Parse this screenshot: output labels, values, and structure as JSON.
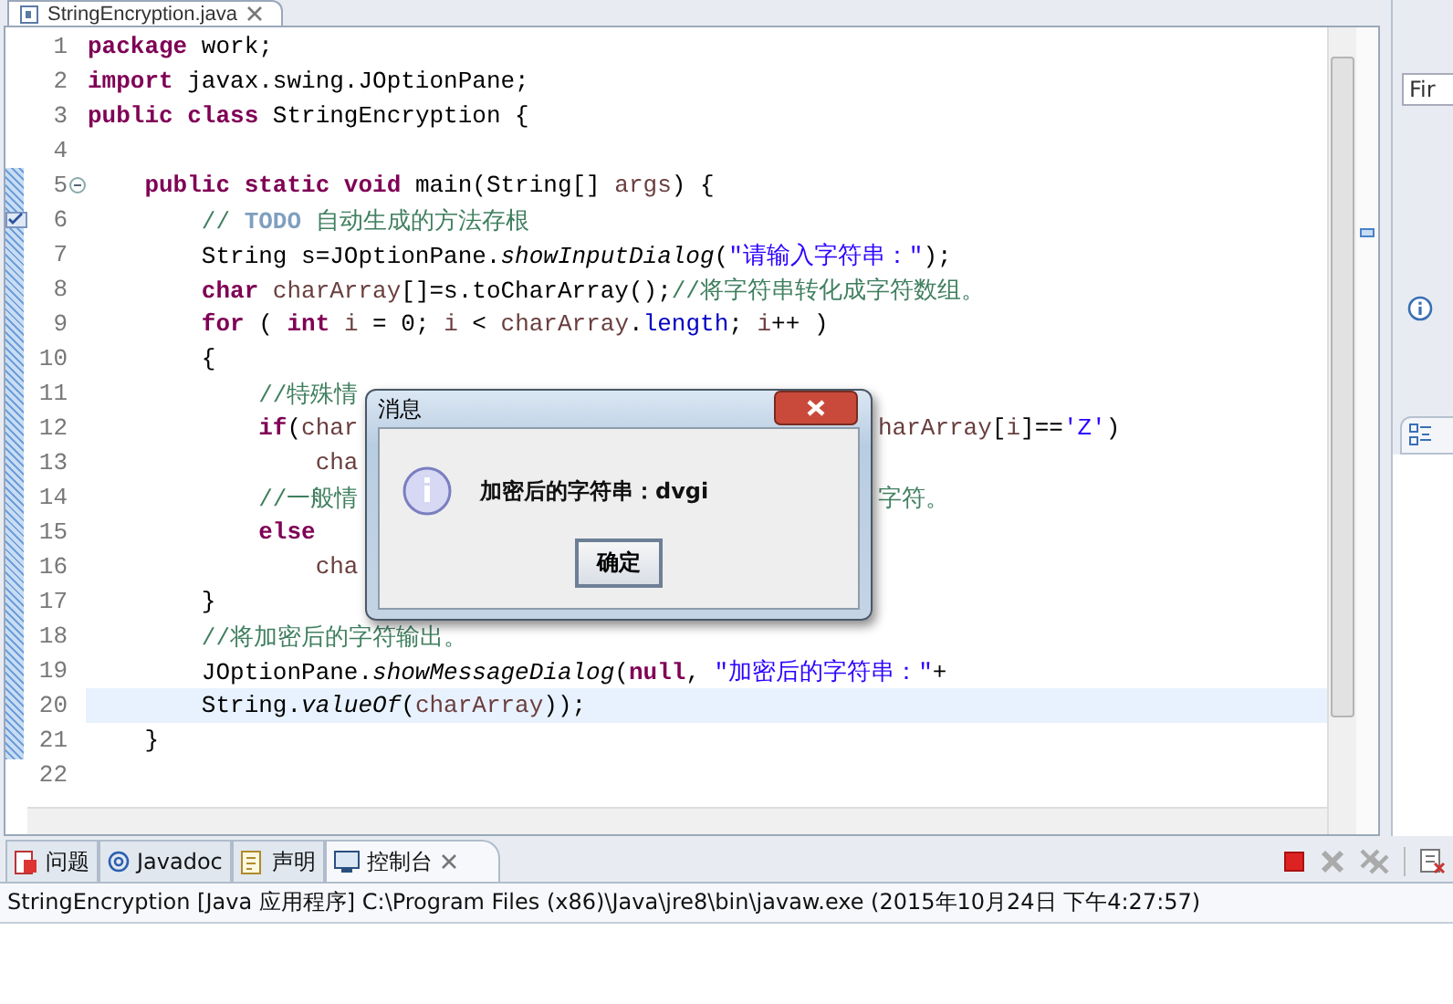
{
  "editor": {
    "tab": {
      "title": "StringEncryption.java",
      "selected": true
    },
    "lines": [
      {
        "number": "1",
        "current": false,
        "tokens": [
          {
            "kind": "keyword",
            "text": "package"
          },
          {
            "kind": "plain",
            "text": " work;"
          }
        ]
      },
      {
        "number": "2",
        "current": false,
        "tokens": [
          {
            "kind": "keyword",
            "text": "import"
          },
          {
            "kind": "plain",
            "text": " javax.swing.JOptionPane;"
          }
        ]
      },
      {
        "number": "3",
        "current": false,
        "tokens": [
          {
            "kind": "keyword",
            "text": "public"
          },
          {
            "kind": "keyword",
            "text": " class"
          },
          {
            "kind": "plain",
            "text": " StringEncryption {"
          }
        ]
      },
      {
        "number": "4",
        "current": false
      },
      {
        "number": "5",
        "current": false,
        "folded": false,
        "tokens": [
          {
            "kind": "keyword",
            "text": "    public"
          },
          {
            "kind": "keyword",
            "text": " static"
          },
          {
            "kind": "keyword",
            "text": " void"
          },
          {
            "kind": "plain",
            "text": " main(String[] "
          },
          {
            "kind": "variable",
            "text": "args"
          },
          {
            "kind": "plain",
            "text": ") {"
          }
        ]
      },
      {
        "number": "6",
        "current": false,
        "task": true,
        "tokens": [
          {
            "kind": "comment",
            "text": "        // "
          },
          {
            "kind": "todo",
            "text": "TODO"
          },
          {
            "kind": "comment",
            "text": " 自动生成的方法存根"
          }
        ]
      },
      {
        "number": "7",
        "current": false,
        "tokens": [
          {
            "kind": "plain",
            "text": "        String s=JOptionPane."
          },
          {
            "kind": "method",
            "text": "showInputDialog"
          },
          {
            "kind": "plain",
            "text": "("
          },
          {
            "kind": "string",
            "text": "\"请输入字符串：\""
          },
          {
            "kind": "plain",
            "text": ");"
          }
        ]
      },
      {
        "number": "8",
        "current": false,
        "tokens": [
          {
            "kind": "keyword",
            "text": "        char"
          },
          {
            "kind": "variable",
            "text": " charArray"
          },
          {
            "kind": "plain",
            "text": "[]=s.toCharArray();"
          },
          {
            "kind": "comment",
            "text": "//将字符串转化成字符数组。"
          }
        ]
      },
      {
        "number": "9",
        "current": false,
        "tokens": [
          {
            "kind": "keyword",
            "text": "        for"
          },
          {
            "kind": "plain",
            "text": " ( "
          },
          {
            "kind": "keyword",
            "text": "int"
          },
          {
            "kind": "variable",
            "text": " i"
          },
          {
            "kind": "plain",
            "text": " = 0; "
          },
          {
            "kind": "variable",
            "text": "i"
          },
          {
            "kind": "plain",
            "text": " < "
          },
          {
            "kind": "variable",
            "text": "charArray"
          },
          {
            "kind": "plain",
            "text": "."
          },
          {
            "kind": "field",
            "text": "length"
          },
          {
            "kind": "plain",
            "text": "; "
          },
          {
            "kind": "variable",
            "text": "i"
          },
          {
            "kind": "plain",
            "text": "++ )"
          }
        ]
      },
      {
        "number": "10",
        "current": false,
        "tokens": [
          {
            "kind": "plain",
            "text": "        {"
          }
        ]
      },
      {
        "number": "11",
        "current": false,
        "tokens": [
          {
            "kind": "comment",
            "text": "            //特殊情"
          }
        ]
      },
      {
        "number": "12",
        "current": false,
        "tokens": [
          {
            "kind": "keyword",
            "text": "            if"
          },
          {
            "kind": "plain",
            "text": "("
          },
          {
            "kind": "variable",
            "text": "char"
          }
        ],
        "tokens_after_dialog": [
          {
            "kind": "variable",
            "text": "harArray"
          },
          {
            "kind": "plain",
            "text": "["
          },
          {
            "kind": "variable",
            "text": "i"
          },
          {
            "kind": "plain",
            "text": "]=="
          },
          {
            "kind": "string",
            "text": "'Z'"
          },
          {
            "kind": "plain",
            "text": ")"
          }
        ]
      },
      {
        "number": "13",
        "current": false,
        "tokens": [
          {
            "kind": "variable",
            "text": "                cha"
          }
        ]
      },
      {
        "number": "14",
        "current": false,
        "tokens": [
          {
            "kind": "comment",
            "text": "            //一般情"
          }
        ],
        "tokens_after_dialog": [
          {
            "kind": "comment",
            "text": "字符。"
          }
        ]
      },
      {
        "number": "15",
        "current": false,
        "tokens": [
          {
            "kind": "keyword",
            "text": "            else"
          }
        ]
      },
      {
        "number": "16",
        "current": false,
        "tokens": [
          {
            "kind": "variable",
            "text": "                cha"
          }
        ]
      },
      {
        "number": "17",
        "current": false,
        "tokens": [
          {
            "kind": "plain",
            "text": "        }"
          }
        ]
      },
      {
        "number": "18",
        "current": false,
        "tokens": [
          {
            "kind": "comment",
            "text": "        //将加密后的字符输出。"
          }
        ]
      },
      {
        "number": "19",
        "current": false,
        "tokens": [
          {
            "kind": "plain",
            "text": "        JOptionPane."
          },
          {
            "kind": "method",
            "text": "showMessageDialog"
          },
          {
            "kind": "plain",
            "text": "("
          },
          {
            "kind": "keyword",
            "text": "null"
          },
          {
            "kind": "plain",
            "text": ", "
          },
          {
            "kind": "string",
            "text": "\"加密后的字符串：\""
          },
          {
            "kind": "plain",
            "text": "+"
          }
        ]
      },
      {
        "number": "20",
        "current": true,
        "tokens": [
          {
            "kind": "plain",
            "text": "        String."
          },
          {
            "kind": "method",
            "text": "valueOf"
          },
          {
            "kind": "plain",
            "text": "("
          },
          {
            "kind": "variable",
            "text": "charArray"
          },
          {
            "kind": "plain",
            "text": "));"
          }
        ]
      },
      {
        "number": "21",
        "current": false,
        "tokens": [
          {
            "kind": "plain",
            "text": "    }"
          }
        ]
      },
      {
        "number": "22",
        "current": false
      }
    ]
  },
  "dialog": {
    "title": "消息",
    "message": "加密后的字符串：dvgi",
    "button": "确定"
  },
  "side_panel": {
    "find_placeholder": "Fir"
  },
  "bottom_panel": {
    "tabs": [
      {
        "label": "问题",
        "selected": false
      },
      {
        "label": "Javadoc",
        "selected": false
      },
      {
        "label": "声明",
        "selected": false
      },
      {
        "label": "控制台",
        "selected": true
      }
    ],
    "console_header": "StringEncryption [Java 应用程序] C:\\Program Files (x86)\\Java\\jre8\\bin\\javaw.exe (2015年10月24日 下午4:27:57)"
  }
}
